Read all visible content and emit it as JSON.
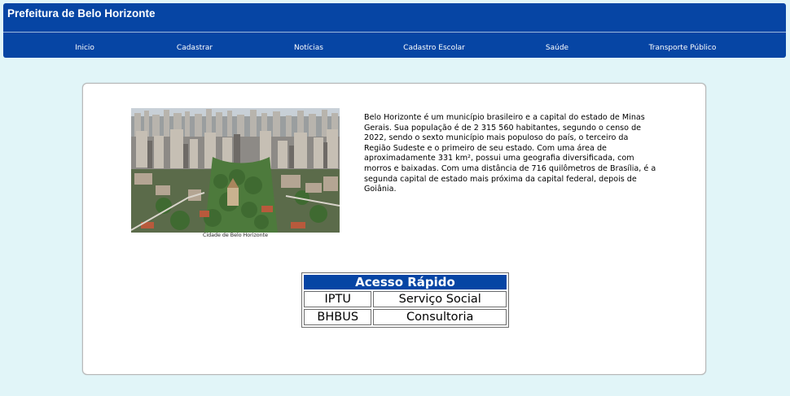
{
  "header": {
    "title": "Prefeitura de Belo Horizonte",
    "nav": [
      "Inicio",
      "Cadastrar",
      "Notícias",
      "Cadastro Escolar",
      "Saúde",
      "Transporte Público"
    ]
  },
  "main": {
    "image_caption": "Cidade de Belo Horizonte",
    "description": "Belo Horizonte é um município brasileiro e a capital do estado de Minas Gerais. Sua população é de 2 315 560 habitantes, segundo o censo de 2022, sendo o sexto município mais populoso do país, o terceiro da Região Sudeste e o primeiro de seu estado. Com uma área de aproximadamente 331 km², possui uma geografia diversificada, com morros e baixadas. Com uma distância de 716 quilômetros de Brasília, é a segunda capital de estado mais próxima da capital federal, depois de Goiânia."
  },
  "quick_access": {
    "title": "Acesso Rápido",
    "items": [
      "IPTU",
      "Serviço Social",
      "BHBUS",
      "Consultoria"
    ]
  },
  "colors": {
    "header_bg": "#0645a4",
    "page_bg": "#e1f5f8"
  }
}
